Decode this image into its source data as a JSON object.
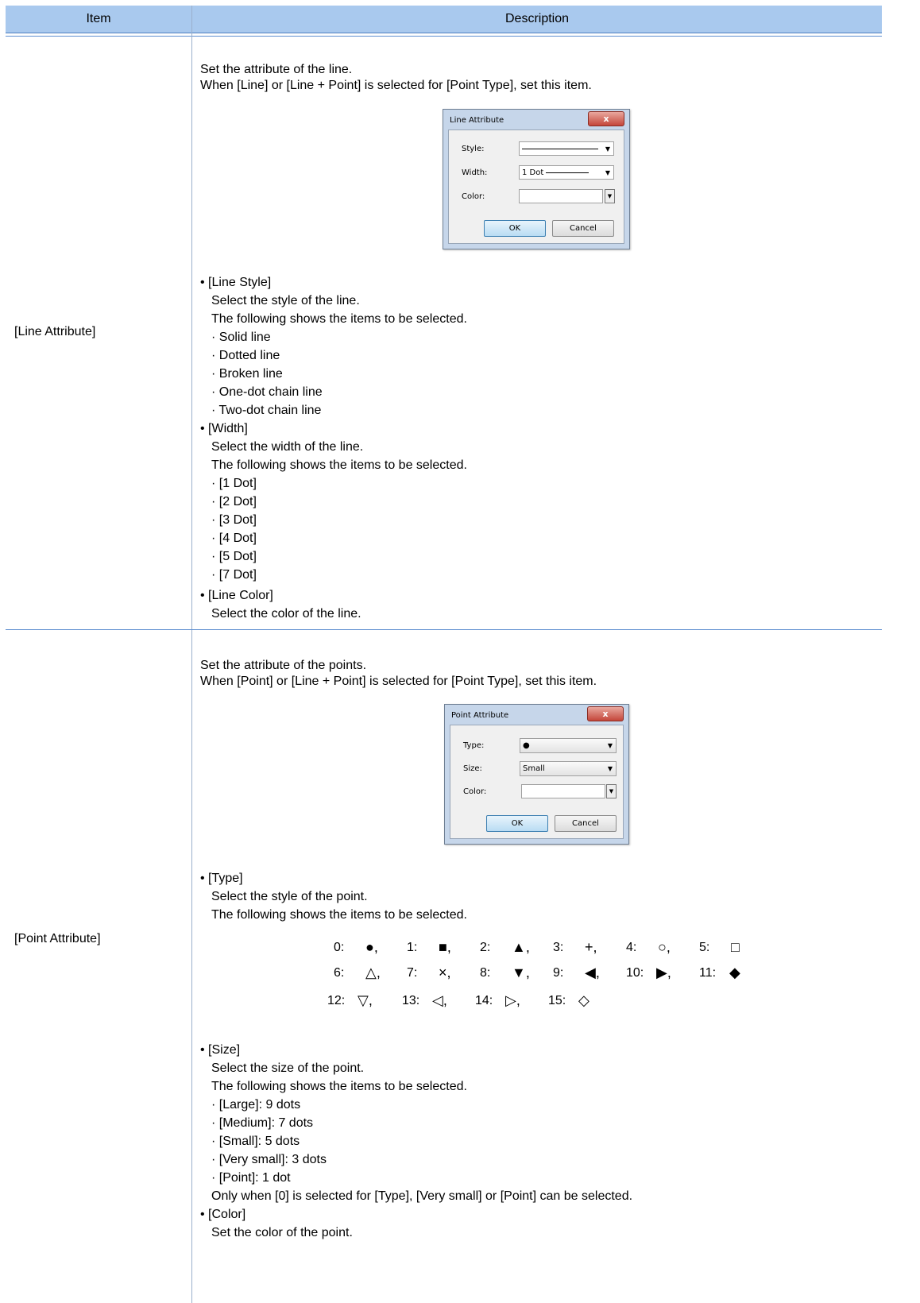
{
  "header": {
    "item": "Item",
    "description": "Description"
  },
  "rows": [
    {
      "item": "[Line Attribute]",
      "intro": [
        "Set the attribute of the line.",
        "When [Line] or [Line + Point] is selected for [Point Type], set this item."
      ],
      "dialog": {
        "title": "Line Attribute",
        "close": "x",
        "style_label": "Style:",
        "width_label": "Width:",
        "width_value": "1 Dot",
        "color_label": "Color:",
        "ok": "OK",
        "cancel": "Cancel"
      },
      "bullets": [
        {
          "head": "• [Line Style]",
          "lines": [
            "Select the style of the line.",
            "The following shows the items to be selected.",
            "· Solid line",
            "· Dotted line",
            "· Broken line",
            "· One-dot chain line",
            "· Two-dot chain line"
          ]
        },
        {
          "head": "• [Width]",
          "lines": [
            "Select the width of the line.",
            "The following shows the items to be selected.",
            "· [1 Dot]",
            "· [2 Dot]",
            "· [3 Dot]",
            "· [4 Dot]",
            "· [5 Dot]",
            "· [7 Dot]"
          ]
        },
        {
          "head": "• [Line Color]",
          "lines": [
            "Select the color of the line."
          ]
        }
      ]
    },
    {
      "item": "[Point Attribute]",
      "intro": [
        "Set the attribute of the points.",
        "When [Point] or [Line + Point] is selected for [Point Type], set this item."
      ],
      "dialog": {
        "title": "Point Attribute",
        "close": "x",
        "type_label": "Type:",
        "type_value": "●",
        "size_label": "Size:",
        "size_value": "Small",
        "color_label": "Color:",
        "ok": "OK",
        "cancel": "Cancel"
      },
      "type_bullet": {
        "head": "• [Type]",
        "lines": [
          "Select the style of the point.",
          "The following shows the items to be selected."
        ]
      },
      "symbols": [
        [
          "0:",
          "●,",
          "1:",
          "■,",
          "2:",
          "▲,",
          "3:",
          "+,",
          "4:",
          "○,",
          "5:",
          "□"
        ],
        [
          "6:",
          "△,",
          "7:",
          "×,",
          "8:",
          "▼,",
          "9:",
          "◀,",
          "10:",
          "▶,",
          "11:",
          "◆"
        ],
        [
          "12:",
          "▽,",
          "13:",
          "◁,",
          "14:",
          "▷,",
          "15:",
          "◇"
        ]
      ],
      "bullets": [
        {
          "head": "• [Size]",
          "lines": [
            "Select the size of the point.",
            "The following shows the items to be selected.",
            "· [Large]: 9 dots",
            "· [Medium]: 7 dots",
            "· [Small]: 5 dots",
            "· [Very small]: 3 dots",
            "· [Point]: 1 dot",
            "Only when [0] is selected for [Type], [Very small] or [Point] can be selected."
          ]
        },
        {
          "head": "• [Color]",
          "lines": [
            "Set the color of the point."
          ]
        }
      ]
    }
  ]
}
